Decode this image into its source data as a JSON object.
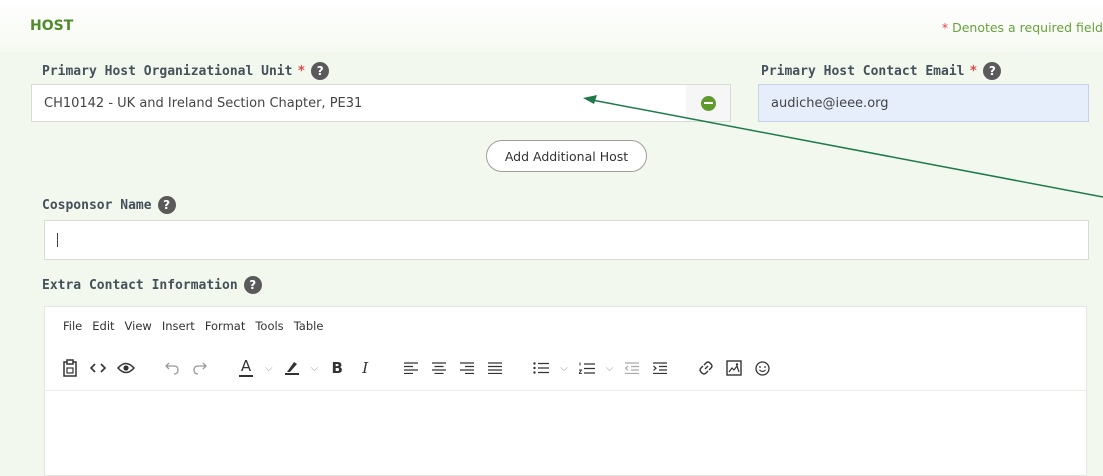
{
  "header": {
    "title": "HOST",
    "required_star": "*",
    "required_note": "Denotes a required field"
  },
  "primary_host": {
    "label": "Primary Host Organizational Unit",
    "star": "*",
    "help": "?",
    "value": "CH10142 - UK and Ireland Section Chapter, PE31"
  },
  "contact_email": {
    "label": "Primary Host Contact Email",
    "star": "*",
    "help": "?",
    "value": "audiche@ieee.org"
  },
  "add_host": {
    "label": "Add Additional Host"
  },
  "cosponsor": {
    "label": "Cosponsor Name",
    "help": "?",
    "value": ""
  },
  "extra_contact": {
    "label": "Extra Contact Information",
    "help": "?"
  },
  "editor": {
    "menu": [
      "File",
      "Edit",
      "View",
      "Insert",
      "Format",
      "Tools",
      "Table"
    ],
    "toolbar_icons": [
      "paste-icon",
      "source-code-icon",
      "preview-icon",
      "undo-icon",
      "redo-icon",
      "text-color-icon",
      "highlight-color-icon",
      "bold-icon",
      "italic-icon",
      "align-left-icon",
      "align-center-icon",
      "align-right-icon",
      "justify-icon",
      "bullet-list-icon",
      "numbered-list-icon",
      "outdent-icon",
      "indent-icon",
      "link-icon",
      "image-icon",
      "emoji-icon"
    ],
    "bold_glyph": "B",
    "italic_glyph": "I",
    "text_color_glyph": "A"
  },
  "colors": {
    "accent_green": "#4f8a2b",
    "required_red": "#e0484a",
    "annotation_arrow": "#1e7a4a"
  }
}
